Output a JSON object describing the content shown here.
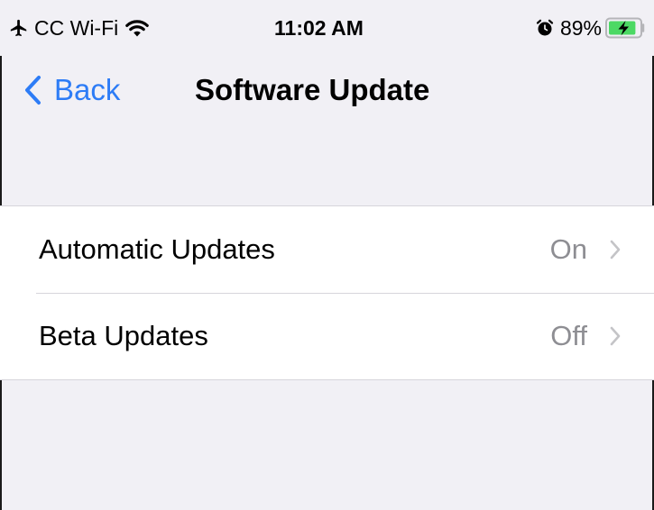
{
  "status_bar": {
    "carrier": "CC Wi-Fi",
    "time": "11:02 AM",
    "battery_percent": "89%",
    "battery_level": 0.89,
    "icons": [
      "airplane-icon",
      "wifi-icon",
      "alarm-icon",
      "battery-charging-icon"
    ]
  },
  "nav": {
    "back_label": "Back",
    "title": "Software Update"
  },
  "settings": {
    "rows": [
      {
        "label": "Automatic Updates",
        "value": "On"
      },
      {
        "label": "Beta Updates",
        "value": "Off"
      }
    ]
  },
  "colors": {
    "accent": "#2d7cf6",
    "background": "#f1f0f5",
    "secondary_text": "#8e8e93",
    "battery_fill": "#4cd964"
  }
}
